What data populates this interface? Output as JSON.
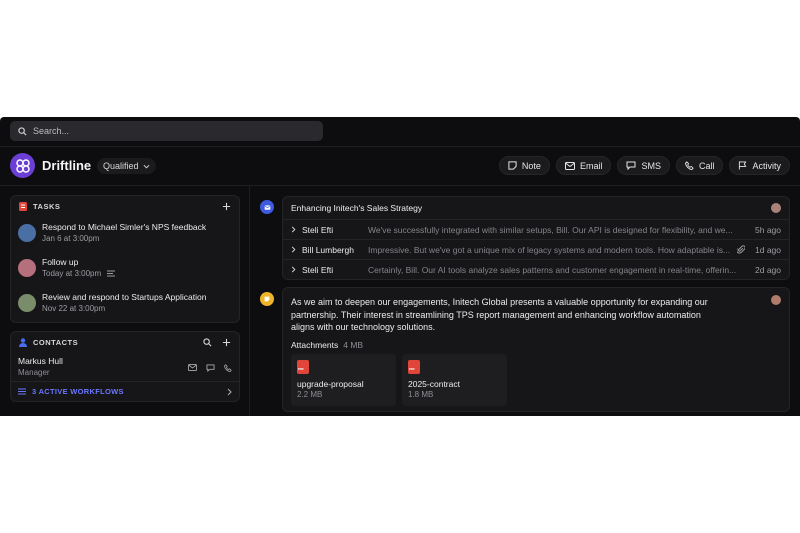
{
  "search": {
    "placeholder": "Search..."
  },
  "header": {
    "app_name": "Driftline",
    "status": "Qualified",
    "actions": [
      "Note",
      "Email",
      "SMS",
      "Call",
      "Activity"
    ]
  },
  "tasks": {
    "title": "TASKS",
    "items": [
      {
        "title": "Respond to Michael Simler's NPS feedback",
        "due": "Jan 6 at 3:00pm",
        "avatar": "#4a6fa5"
      },
      {
        "title": "Follow up",
        "due": "Today at 3:00pm",
        "avatar": "#b56f7d"
      },
      {
        "title": "Review and respond to Startups Application",
        "due": "Nov 22 at 3:00pm",
        "avatar": "#7a8d6a"
      }
    ]
  },
  "contacts": {
    "title": "CONTACTS",
    "items": [
      {
        "name": "Markus Hull",
        "role": "Manager"
      }
    ],
    "workflows": "3 ACTIVE WORKFLOWS"
  },
  "thread": {
    "title": "Enhancing Initech's Sales Strategy",
    "messages": [
      {
        "from": "Steli Efti",
        "preview": "We've successfully integrated with similar setups, Bill. Our API is designed for flexibility, and we...",
        "time": "5h ago"
      },
      {
        "from": "Bill Lumbergh",
        "preview": "Impressive. But we've got a unique mix of legacy systems and modern tools. How adaptable is...",
        "time": "1d ago"
      },
      {
        "from": "Steli Efti",
        "preview": "Certainly, Bill. Our AI tools analyze sales patterns and customer engagement in real-time, offerin...",
        "time": "2d ago"
      }
    ]
  },
  "note": {
    "body": "As we aim to deepen our engagements, Initech Global presents a valuable opportunity for expanding our partnership. Their interest in streamlining TPS report management and enhancing workflow automation aligns with our technology solutions.",
    "attachments_label": "Attachments",
    "attachments_size": "4 MB",
    "files": [
      {
        "name": "upgrade-proposal",
        "size": "2.2 MB"
      },
      {
        "name": "2025-contract",
        "size": "1.8 MB"
      }
    ]
  },
  "colors": {
    "accent": "#6b3fd6",
    "link": "#6b77ff",
    "email_dot": "#3e5be0",
    "note_dot": "#f0b429",
    "pdf": "#e0453a"
  }
}
